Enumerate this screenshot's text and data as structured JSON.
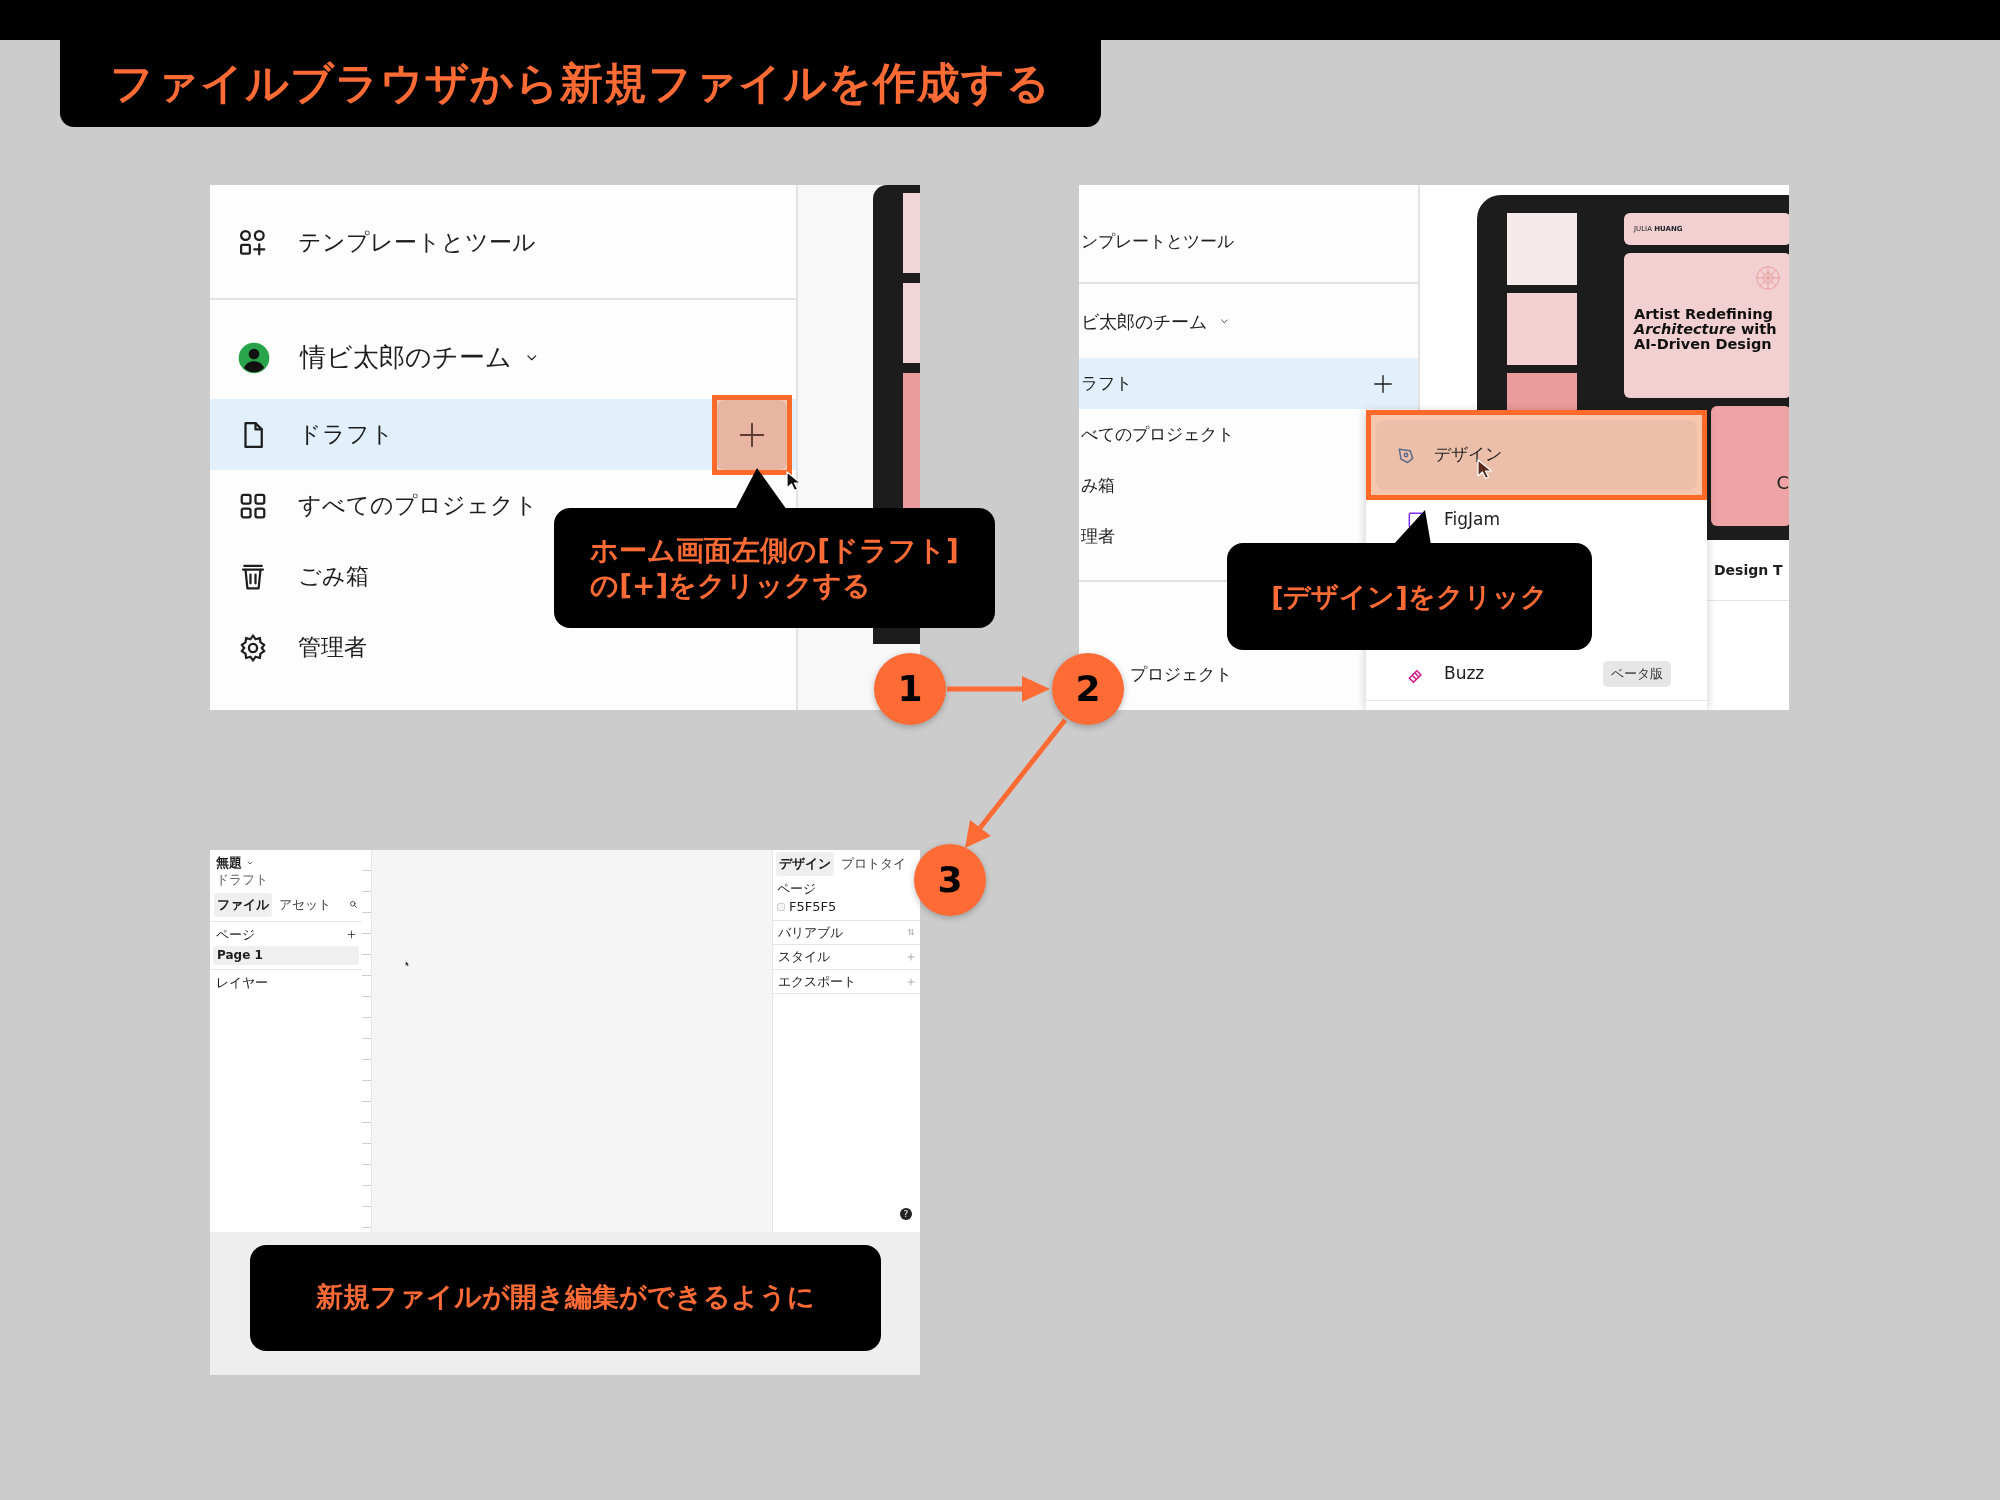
{
  "title": "ファイルブラウザから新規ファイルを作成する",
  "panel_1": {
    "sections": [
      {
        "items": [
          {
            "kind": "nav",
            "label": "テンプレートとツール",
            "selected": false,
            "highlighted": false
          }
        ]
      },
      {
        "items": [
          {
            "kind": "team",
            "label": "情ビ太郎のチーム"
          },
          {
            "kind": "nav",
            "label": "ドラフト",
            "selected": true,
            "highlighted": true
          },
          {
            "kind": "nav",
            "label": "すべてのプロジェクト",
            "selected": false,
            "highlighted": false
          },
          {
            "kind": "nav",
            "label": "ごみ箱",
            "selected": false,
            "highlighted": false
          },
          {
            "kind": "nav",
            "label": "管理者",
            "selected": false,
            "highlighted": false
          }
        ]
      }
    ],
    "callout": "ホーム画面左側の[ドラフト]\nの[+]をクリックする"
  },
  "panel_2": {
    "sections": [
      {
        "items": [
          {
            "kind": "nav",
            "label": "ンプレートとツール",
            "selected": false,
            "highlighted": false
          }
        ]
      },
      {
        "items": [
          {
            "kind": "team",
            "label": "ビ太郎のチーム"
          },
          {
            "kind": "nav",
            "label": "ラフト",
            "selected": true,
            "highlighted": false
          },
          {
            "kind": "nav",
            "label": "べてのプロジェクト",
            "selected": false,
            "highlighted": false
          },
          {
            "kind": "nav",
            "label": "み箱",
            "selected": false,
            "highlighted": false
          },
          {
            "kind": "nav",
            "label": "理者",
            "selected": false,
            "highlighted": false
          }
        ]
      },
      {
        "items": [
          {
            "kind": "nav",
            "label": "プロジェクト",
            "selected": false,
            "highlighted": false
          }
        ]
      }
    ],
    "preview": {
      "header": "JULIA **HUANG**",
      "headline": "Artist Redefining\n*Architecture* with\nAI-Driven Design",
      "card_text": "C",
      "caption": "Design T"
    },
    "menu": [
      {
        "label": "デザイン",
        "selected": true,
        "highlighted": true
      },
      {
        "label": "FigJam",
        "selected": false,
        "highlighted": false
      },
      {
        "label": "Buzz",
        "selected": false,
        "highlighted": false,
        "badge": "ベータ版"
      }
    ],
    "callout": "[デザイン]をクリック"
  },
  "panel_3": {
    "file_title": "無題",
    "location": "ドラフト",
    "left_tabs": [
      {
        "label": "ファイル",
        "selected": true
      },
      {
        "label": "アセット",
        "selected": false
      }
    ],
    "pages_heading": "ページ",
    "pages": [
      {
        "label": "Page 1",
        "selected": true
      }
    ],
    "layers_heading": "レイヤー",
    "right_tabs": [
      {
        "label": "デザイン",
        "selected": true
      },
      {
        "label": "プロトタイ",
        "selected": false
      }
    ],
    "page_heading": "ページ",
    "background": "F5F5F5",
    "sections": [
      "バリアブル",
      "スタイル",
      "エクスポート"
    ],
    "help": "?",
    "callout": "新規ファイルが開き編集ができるように"
  },
  "steps": [
    {
      "number": "1"
    },
    {
      "number": "2"
    },
    {
      "number": "3"
    }
  ]
}
